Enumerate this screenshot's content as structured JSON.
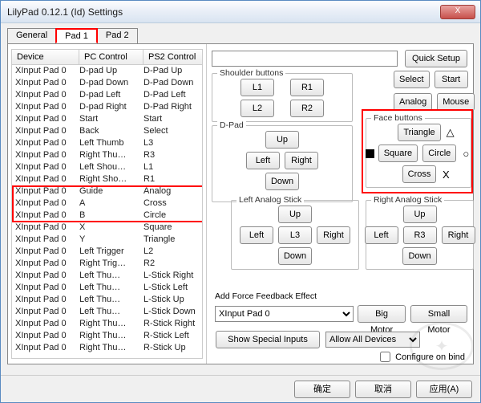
{
  "title": "LilyPad 0.12.1 (Id) Settings",
  "close_x": "X",
  "tabs": {
    "general": "General",
    "pad1": "Pad 1",
    "pad2": "Pad 2"
  },
  "columns": {
    "device": "Device",
    "pc": "PC Control",
    "ps2": "PS2 Control"
  },
  "rows": [
    {
      "d": "XInput Pad 0",
      "p": "D-pad Up",
      "s": "D-Pad Up"
    },
    {
      "d": "XInput Pad 0",
      "p": "D-pad Down",
      "s": "D-Pad Down"
    },
    {
      "d": "XInput Pad 0",
      "p": "D-pad Left",
      "s": "D-Pad Left"
    },
    {
      "d": "XInput Pad 0",
      "p": "D-pad Right",
      "s": "D-Pad Right"
    },
    {
      "d": "XInput Pad 0",
      "p": "Start",
      "s": "Start"
    },
    {
      "d": "XInput Pad 0",
      "p": "Back",
      "s": "Select"
    },
    {
      "d": "XInput Pad 0",
      "p": "Left Thumb",
      "s": "L3"
    },
    {
      "d": "XInput Pad 0",
      "p": "Right Thu…",
      "s": "R3"
    },
    {
      "d": "XInput Pad 0",
      "p": "Left Shou…",
      "s": "L1"
    },
    {
      "d": "XInput Pad 0",
      "p": "Right Sho…",
      "s": "R1"
    },
    {
      "d": "XInput Pad 0",
      "p": "Guide",
      "s": "Analog"
    },
    {
      "d": "XInput Pad 0",
      "p": "A",
      "s": "Cross"
    },
    {
      "d": "XInput Pad 0",
      "p": "B",
      "s": "Circle"
    },
    {
      "d": "XInput Pad 0",
      "p": "X",
      "s": "Square"
    },
    {
      "d": "XInput Pad 0",
      "p": "Y",
      "s": "Triangle"
    },
    {
      "d": "XInput Pad 0",
      "p": "Left Trigger",
      "s": "L2"
    },
    {
      "d": "XInput Pad 0",
      "p": "Right Trig…",
      "s": "R2"
    },
    {
      "d": "XInput Pad 0",
      "p": "Left Thu…",
      "s": "L-Stick Right"
    },
    {
      "d": "XInput Pad 0",
      "p": "Left Thu…",
      "s": "L-Stick Left"
    },
    {
      "d": "XInput Pad 0",
      "p": "Left Thu…",
      "s": "L-Stick Up"
    },
    {
      "d": "XInput Pad 0",
      "p": "Left Thu…",
      "s": "L-Stick Down"
    },
    {
      "d": "XInput Pad 0",
      "p": "Right Thu…",
      "s": "R-Stick Right"
    },
    {
      "d": "XInput Pad 0",
      "p": "Right Thu…",
      "s": "R-Stick Left"
    },
    {
      "d": "XInput Pad 0",
      "p": "Right Thu…",
      "s": "R-Stick Up"
    }
  ],
  "quick_setup": "Quick Setup",
  "shoulder": {
    "label": "Shoulder buttons",
    "l1": "L1",
    "r1": "R1",
    "l2": "L2",
    "r2": "R2"
  },
  "misc": {
    "select": "Select",
    "start": "Start",
    "analog": "Analog",
    "mouse": "Mouse"
  },
  "dpad": {
    "label": "D-Pad",
    "up": "Up",
    "down": "Down",
    "left": "Left",
    "right": "Right"
  },
  "face": {
    "label": "Face buttons",
    "triangle": "Triangle",
    "square": "Square",
    "circle": "Circle",
    "cross": "Cross",
    "tri_sym": "△",
    "circ_sym": "○",
    "cross_sym": "X"
  },
  "lstick": {
    "label": "Left Analog Stick",
    "up": "Up",
    "down": "Down",
    "left": "Left",
    "right": "Right",
    "l3": "L3"
  },
  "rstick": {
    "label": "Right Analog Stick",
    "up": "Up",
    "down": "Down",
    "left": "Left",
    "right": "Right",
    "r3": "R3"
  },
  "ff": {
    "label": "Add Force Feedback Effect",
    "device": "XInput Pad 0",
    "big": "Big Motor",
    "small": "Small Motor"
  },
  "special": "Show Special Inputs",
  "allow": "Allow All Devices",
  "configure": "Configure on bind",
  "footer": {
    "ok": "确定",
    "cancel": "取消",
    "apply": "应用(A)"
  }
}
